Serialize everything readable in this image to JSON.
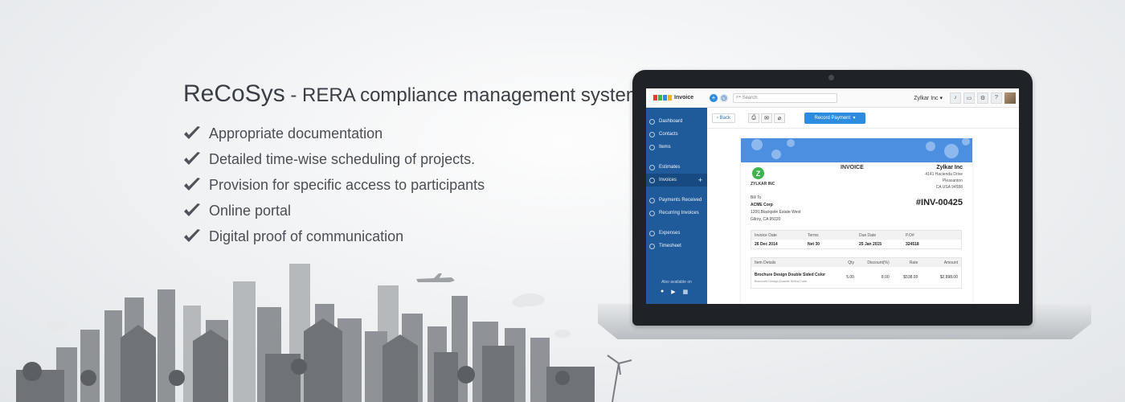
{
  "hero": {
    "brand": "ReCoSys",
    "separator": " - ",
    "subtitle": "RERA compliance management system",
    "features": [
      "Appropriate documentation",
      "Detailed time-wise scheduling of projects.",
      "Provision for specific access to participants",
      "Online portal",
      "Digital proof of communication"
    ]
  },
  "app": {
    "logo_text": "Invoice",
    "search_placeholder": "Search",
    "org_name": "Zylkar Inc",
    "sidebar": {
      "items": [
        "Dashboard",
        "Contacts",
        "Items",
        "Estimates",
        "Invoices",
        "Payments Received",
        "Recurring Invoices",
        "Expenses",
        "Timesheet"
      ],
      "active": "Invoices",
      "also_available": "Also available on"
    },
    "toolbar": {
      "back_label": "Back",
      "record_label": "Record Payment"
    },
    "invoice": {
      "title": "INVOICE",
      "logo_letter": "Z",
      "company_small": "ZYLKAR INC",
      "from": {
        "name": "Zylkar Inc",
        "line1": "4141 Hacienda Drive",
        "line2": "Pleasanton",
        "line3": "CA USA 94588"
      },
      "bill_to": {
        "label": "Bill To",
        "name": "ACME Corp",
        "line1": "1200,Blackpole Estate West",
        "line2": "Gilroy, CA 95020"
      },
      "number": "#INV-00425",
      "meta_headers": [
        "Invoice Date",
        "Terms",
        "Due Date",
        "P.O#"
      ],
      "meta_values": [
        "26 Dec 2014",
        "Net 30",
        "25 Jan 2015",
        "324518"
      ],
      "item_headers": [
        "Item Details",
        "Qty",
        "Discount(%)",
        "Rate",
        "Amount"
      ],
      "item": {
        "name": "Brochure Design Double Sided Color",
        "desc": "Brochure Design Double Sided Color",
        "qty": "5.00",
        "discount": "8.00",
        "rate": "$538.00",
        "amount": "$2,898.00"
      }
    }
  },
  "colors": {
    "sidebar": "#1f5b9a",
    "accent": "#2d8be0",
    "banner": "#4c8fe0",
    "skyline": "#8f9296"
  }
}
